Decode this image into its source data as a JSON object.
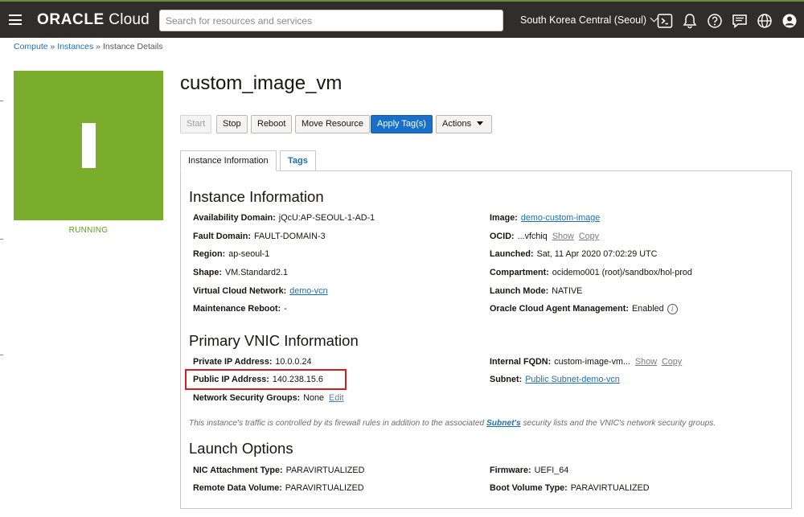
{
  "header": {
    "logo_bold": "ORACLE",
    "logo_rest": " Cloud",
    "search_placeholder": "Search for resources and services",
    "region": "South Korea Central (Seoul)"
  },
  "breadcrumb": {
    "items": [
      "Compute",
      "Instances",
      "Instance Details"
    ],
    "separator": "»"
  },
  "instance": {
    "name": "custom_image_vm",
    "status": "RUNNING",
    "tile_color": "#7aad2c"
  },
  "buttons": {
    "start": "Start",
    "stop": "Stop",
    "reboot": "Reboot",
    "move": "Move Resource",
    "apply_tags": "Apply Tag(s)",
    "actions": "Actions"
  },
  "tabs": {
    "info": "Instance Information",
    "tags": "Tags"
  },
  "instance_info": {
    "heading": "Instance Information",
    "left": [
      {
        "key": "Availability Domain:",
        "value": "jQcU:AP-SEOUL-1-AD-1"
      },
      {
        "key": "Fault Domain:",
        "value": "FAULT-DOMAIN-3"
      },
      {
        "key": "Region:",
        "value": "ap-seoul-1"
      },
      {
        "key": "Shape:",
        "value": "VM.Standard2.1"
      },
      {
        "key": "Virtual Cloud Network:",
        "value": "demo-vcn"
      },
      {
        "key": "Maintenance Reboot:",
        "value": "-"
      }
    ],
    "right": [
      {
        "key": "Image:",
        "value": "demo-custom-image"
      },
      {
        "key": "OCID:",
        "value": "...vfchiq",
        "show": "Show",
        "copy": "Copy"
      },
      {
        "key": "Launched:",
        "value": "Sat, 11 Apr 2020 07:02:29 UTC"
      },
      {
        "key": "Compartment:",
        "value": "ocidemo001 (root)/sandbox/hol-prod"
      },
      {
        "key": "Launch Mode:",
        "value": "NATIVE"
      },
      {
        "key": "Oracle Cloud Agent Management:",
        "value": "Enabled",
        "info": "i"
      }
    ]
  },
  "vnic_info": {
    "heading": "Primary VNIC Information",
    "private_ip": {
      "key": "Private IP Address:",
      "value": "10.0.0.24"
    },
    "public_ip": {
      "key": "Public IP Address:",
      "value": "140.238.15.6"
    },
    "nsg": {
      "key": "Network Security Groups:",
      "value": "None",
      "edit": "Edit"
    },
    "fqdn": {
      "key": "Internal FQDN:",
      "value": "custom-image-vm...",
      "show": "Show",
      "copy": "Copy"
    },
    "subnet": {
      "key": "Subnet:",
      "value": "Public Subnet-demo-vcn"
    },
    "note_pre": "This instance's traffic is controlled by its firewall rules in addition to the associated ",
    "note_link": "Subnet's",
    "note_post": " security lists and the VNIC's network security groups."
  },
  "launch_options": {
    "heading": "Launch Options",
    "nic": {
      "key": "NIC Attachment Type:",
      "value": "PARAVIRTUALIZED"
    },
    "remote": {
      "key": "Remote Data Volume:",
      "value": "PARAVIRTUALIZED"
    },
    "firmware": {
      "key": "Firmware:",
      "value": "UEFI_64"
    },
    "boot": {
      "key": "Boot Volume Type:",
      "value": "PARAVIRTUALIZED"
    }
  }
}
